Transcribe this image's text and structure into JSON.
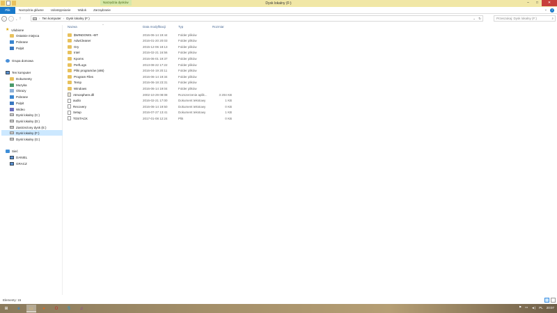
{
  "window": {
    "title": "Dysk lokalny (F:)",
    "context_tab": "Narzędzia dysków",
    "controls": {
      "minimize": "–",
      "maximize": "□",
      "close": "✕"
    }
  },
  "ribbon": {
    "tabs": [
      "Plik",
      "Narzędzia główne",
      "Udostępnianie",
      "Widok",
      "Zarządzanie"
    ],
    "collapse_glyph": "⌄",
    "help_glyph": "?"
  },
  "address_bar": {
    "back_glyph": "←",
    "forward_glyph": "→",
    "history_glyph": "⌄",
    "up_glyph": "↑",
    "breadcrumbs": [
      "Ten komputer",
      "Dysk lokalny (F:)"
    ],
    "separator": "›",
    "dropdown_glyph": "⌄",
    "refresh_glyph": "↻"
  },
  "search": {
    "placeholder": "Przeszukaj: Dysk lokalny (F:)",
    "icon_glyph": "⌕"
  },
  "nav": {
    "items": [
      {
        "label": "Ulubione",
        "icon": "star-icon"
      },
      {
        "label": "Ostatnie miejsca",
        "icon": "recent-places-icon"
      },
      {
        "label": "Pobrane",
        "icon": "downloads-icon"
      },
      {
        "label": "Pulpit",
        "icon": "desktop-icon"
      },
      {
        "label": "Grupa domowa",
        "icon": "homegroup-icon"
      },
      {
        "label": "Ten komputer",
        "icon": "computer-icon"
      },
      {
        "label": "Dokumenty",
        "icon": "documents-icon"
      },
      {
        "label": "Muzyka",
        "icon": "music-icon"
      },
      {
        "label": "Obrazy",
        "icon": "pictures-icon"
      },
      {
        "label": "Pobrane",
        "icon": "downloads-icon"
      },
      {
        "label": "Pulpit",
        "icon": "desktop-icon"
      },
      {
        "label": "Wideo",
        "icon": "videos-icon"
      },
      {
        "label": "Dysk lokalny (C:)",
        "icon": "drive-icon"
      },
      {
        "label": "Dysk lokalny (D:)",
        "icon": "drive-icon"
      },
      {
        "label": "Zastrzeżony dysk (E:)",
        "icon": "drive-icon"
      },
      {
        "label": "Dysk lokalny (F:)",
        "icon": "drive-icon",
        "selected": true
      },
      {
        "label": "Dysk lokalny (G:)",
        "icon": "drive-icon"
      },
      {
        "label": "Sieć",
        "icon": "network-icon"
      },
      {
        "label": "DANIEL",
        "icon": "network-computer-icon"
      },
      {
        "label": "GRACZ",
        "icon": "network-computer-icon"
      }
    ]
  },
  "columns": {
    "name": "Nazwa",
    "date": "Data modyfikacji",
    "type": "Typ",
    "size": "Rozmiar",
    "sort_glyph": "^"
  },
  "files": [
    {
      "name": "$WINDOWS.~BT",
      "date": "2016-06-14 19:44",
      "type": "Folder plików",
      "size": "",
      "kind": "folder"
    },
    {
      "name": "AdwCleaner",
      "date": "2016-01-20 20:03",
      "type": "Folder plików",
      "size": "",
      "kind": "folder"
    },
    {
      "name": "Gry",
      "date": "2015-12-06 18:13",
      "type": "Folder plików",
      "size": "",
      "kind": "folder"
    },
    {
      "name": "Intel",
      "date": "2016-02-21 16:56",
      "type": "Folder plików",
      "size": "",
      "kind": "folder"
    },
    {
      "name": "Kpoms",
      "date": "2016-06-01 19:37",
      "type": "Folder plików",
      "size": "",
      "kind": "folder"
    },
    {
      "name": "PerfLogs",
      "date": "2013-08-22 17:22",
      "type": "Folder plików",
      "size": "",
      "kind": "folder"
    },
    {
      "name": "Pliki programów (x86)",
      "date": "2016-04-19 20:11",
      "type": "Folder plików",
      "size": "",
      "kind": "folder"
    },
    {
      "name": "Program Files",
      "date": "2016-06-14 19:34",
      "type": "Folder plików",
      "size": "",
      "kind": "folder"
    },
    {
      "name": "Temp",
      "date": "2016-06-18 23:31",
      "type": "Folder plików",
      "size": "",
      "kind": "folder"
    },
    {
      "name": "Windows",
      "date": "2016-06-14 19:04",
      "type": "Folder plików",
      "size": "",
      "kind": "folder"
    },
    {
      "name": "Atmosphere.dll",
      "date": "2002-10-29 08:08",
      "type": "Rozszerzenie aplik...",
      "size": "3 204 KB",
      "kind": "dll"
    },
    {
      "name": "audio",
      "date": "2016-02-21 17:00",
      "type": "Dokument tekstowy",
      "size": "1 KB",
      "kind": "file"
    },
    {
      "name": "Recovery",
      "date": "2016-06-14 19:50",
      "type": "Dokument tekstowy",
      "size": "0 KB",
      "kind": "file"
    },
    {
      "name": "Setup",
      "date": "2016-07-27 13:41",
      "type": "Dokument tekstowy",
      "size": "1 KB",
      "kind": "file"
    },
    {
      "name": "TOSTACK",
      "date": "2017-01-08 12:24",
      "type": "Plik",
      "size": "0 KB",
      "kind": "file"
    }
  ],
  "status": {
    "items_label": "Elementy: 15"
  },
  "taskbar": {
    "start_glyph": "⊞",
    "apps": [
      {
        "name": "ie-icon",
        "glyph": "e"
      },
      {
        "name": "explorer-icon",
        "glyph": "▭",
        "active": true
      },
      {
        "name": "firefox-icon",
        "glyph": "●"
      },
      {
        "name": "opera-icon",
        "glyph": "O"
      },
      {
        "name": "skype-icon",
        "glyph": "S"
      },
      {
        "name": "app-purple-icon",
        "glyph": "♫"
      }
    ],
    "tray": {
      "flag_glyph": "⚑",
      "screen_glyph": "▭",
      "volume_glyph": "◄)",
      "lang": "PL",
      "time": "20:07"
    }
  }
}
